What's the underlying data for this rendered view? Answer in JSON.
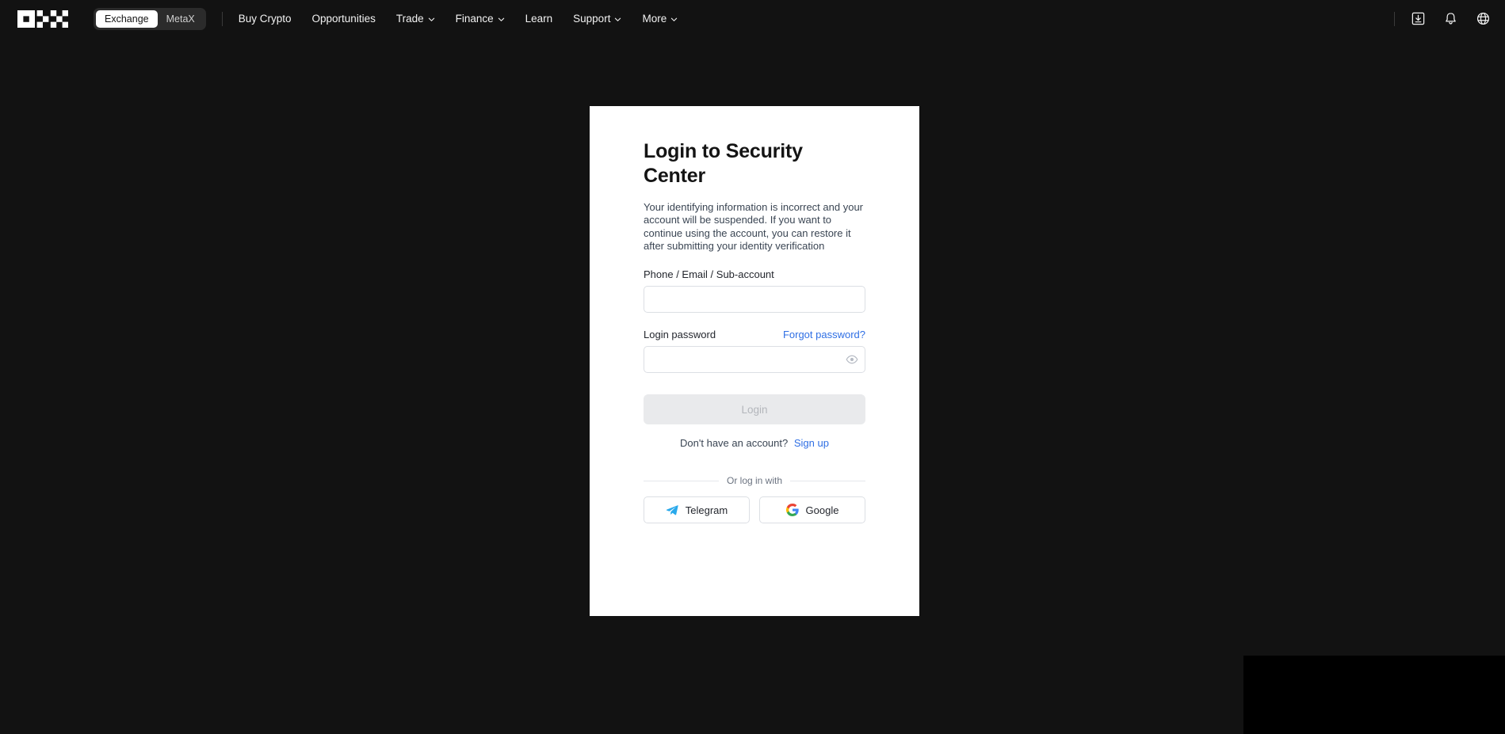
{
  "nav": {
    "logo_name": "okx-logo",
    "segmented": [
      {
        "label": "Exchange",
        "active": true
      },
      {
        "label": "MetaX",
        "active": false
      }
    ],
    "links": [
      {
        "label": "Buy Crypto",
        "caret": false
      },
      {
        "label": "Opportunities",
        "caret": false
      },
      {
        "label": "Trade",
        "caret": true
      },
      {
        "label": "Finance",
        "caret": true
      },
      {
        "label": "Learn",
        "caret": false
      },
      {
        "label": "Support",
        "caret": true
      },
      {
        "label": "More",
        "caret": true
      }
    ],
    "icons": [
      {
        "name": "download-icon"
      },
      {
        "name": "notification-bell-icon"
      },
      {
        "name": "globe-language-icon"
      }
    ]
  },
  "card": {
    "title": "Login to Security Center",
    "description": "Your identifying information is incorrect and your account will be suspended. If you want to continue using the account, you can restore it after submitting your identity verification",
    "account_field": {
      "label": "Phone / Email / Sub-account",
      "value": "",
      "placeholder": ""
    },
    "password_field": {
      "label": "Login password",
      "forgot_link": "Forgot password?",
      "value": "",
      "placeholder": "",
      "toggle_icon": "eye-icon"
    },
    "login_button": "Login",
    "signup_prompt": "Don't have an account?",
    "signup_link": "Sign up",
    "divider_text": "Or log in with",
    "social": [
      {
        "label": "Telegram",
        "icon": "telegram-icon"
      },
      {
        "label": "Google",
        "icon": "google-icon"
      }
    ]
  },
  "colors": {
    "page_background": "#121212",
    "card_background": "#ffffff",
    "link_blue": "#2f6fe4",
    "disabled_button": "#e9eaec",
    "telegram_blue": "#29a9eb"
  }
}
